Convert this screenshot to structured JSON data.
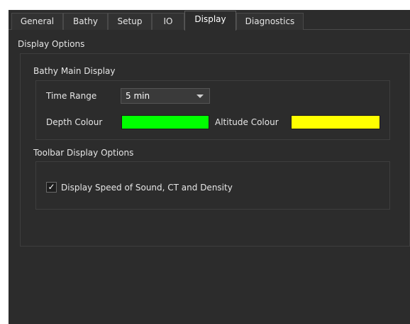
{
  "tabs": [
    {
      "label": "General"
    },
    {
      "label": "Bathy"
    },
    {
      "label": "Setup"
    },
    {
      "label": "IO"
    },
    {
      "label": "Display"
    },
    {
      "label": "Diagnostics"
    }
  ],
  "active_tab": "Display",
  "display_options": {
    "title": "Display Options",
    "bathy_main": {
      "title": "Bathy Main Display",
      "time_range_label": "Time Range",
      "time_range_value": "5 min",
      "depth_colour_label": "Depth Colour",
      "depth_colour": "#00ff00",
      "altitude_colour_label": "Altitude Colour",
      "altitude_colour": "#ffff00"
    },
    "toolbar": {
      "title": "Toolbar Display Options",
      "sound_checkbox_label": "Display Speed of Sound, CT and Density",
      "sound_checkbox_checked": true,
      "check_glyph": "✓"
    }
  },
  "icons": {
    "combo_arrow": "chevron-down-icon",
    "checkbox_mark": "checkmark-icon"
  }
}
